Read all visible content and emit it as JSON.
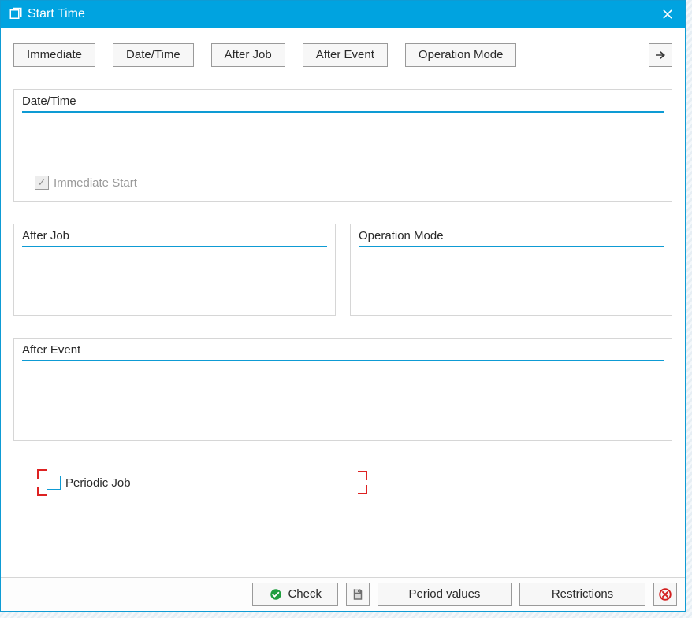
{
  "window": {
    "title": "Start Time"
  },
  "tabs": {
    "immediate": "Immediate",
    "date_time": "Date/Time",
    "after_job": "After Job",
    "after_event": "After Event",
    "operation_mode": "Operation Mode"
  },
  "boxes": {
    "date_time": {
      "title": "Date/Time",
      "immediate_start_label": "Immediate Start",
      "immediate_start_checked": true
    },
    "after_job": {
      "title": "After Job"
    },
    "operation_mode": {
      "title": "Operation Mode"
    },
    "after_event": {
      "title": "After Event"
    }
  },
  "periodic": {
    "label": "Periodic Job",
    "checked": false
  },
  "footer": {
    "check": "Check",
    "period_values": "Period values",
    "restrictions": "Restrictions"
  }
}
